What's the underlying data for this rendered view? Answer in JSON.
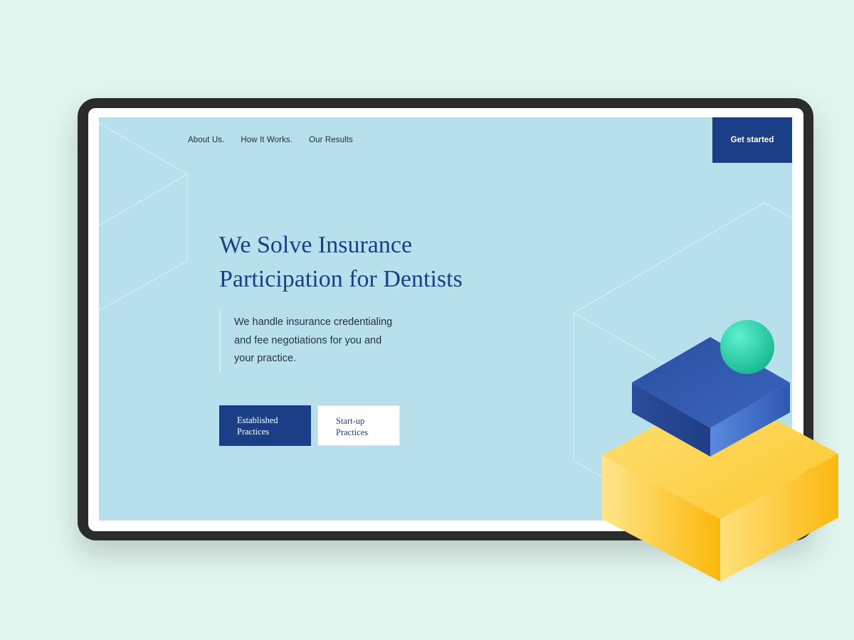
{
  "nav": {
    "items": [
      "About Us.",
      "How It Works.",
      "Our Results"
    ],
    "cta_label": "Get started"
  },
  "hero": {
    "title_line1": "We Solve Insurance",
    "title_line2": "Participation for Dentists",
    "description_line1": "We handle insurance credentialing",
    "description_line2": "and fee negotiations for you and",
    "description_line3": "your practice."
  },
  "buttons": {
    "established_line1": "Established",
    "established_line2": "Practices",
    "startup_line1": "Start-up",
    "startup_line2": "Practices"
  },
  "colors": {
    "page_background": "#e1f5ef",
    "screen_background": "#b8e0ec",
    "brand_navy": "#1b3f87",
    "accent_yellow": "#fcc62a",
    "accent_teal": "#2ed3a8"
  }
}
